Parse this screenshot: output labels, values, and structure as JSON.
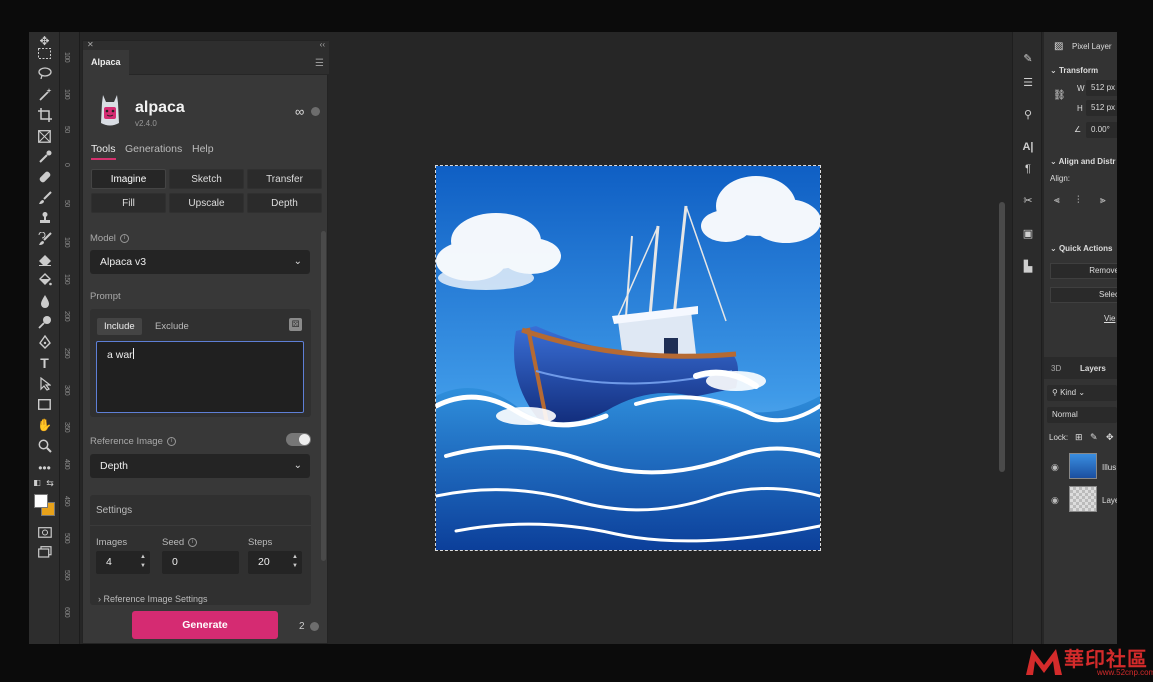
{
  "panel": {
    "tab_label": "Alpaca",
    "app_name": "alpaca",
    "version": "v2.4.0",
    "credits_symbol": "∞",
    "tabs": [
      {
        "label": "Tools",
        "active": true
      },
      {
        "label": "Generations",
        "active": false
      },
      {
        "label": "Help",
        "active": false
      }
    ],
    "modes": [
      {
        "label": "Imagine",
        "active": true
      },
      {
        "label": "Sketch",
        "active": false
      },
      {
        "label": "Transfer",
        "active": false
      },
      {
        "label": "Fill",
        "active": false
      },
      {
        "label": "Upscale",
        "active": false
      },
      {
        "label": "Depth",
        "active": false
      }
    ],
    "model_label": "Model",
    "model_value": "Alpaca v3",
    "prompt_label": "Prompt",
    "prompt_include": "Include",
    "prompt_exclude": "Exclude",
    "prompt_text": "a war",
    "reference_label": "Reference Image",
    "reference_enabled": true,
    "reference_value": "Depth",
    "settings_title": "Settings",
    "images_label": "Images",
    "images_value": "4",
    "seed_label": "Seed",
    "seed_value": "0",
    "steps_label": "Steps",
    "steps_value": "20",
    "reference_settings_label": "Reference Image Settings",
    "generate_label": "Generate",
    "generate_cost": "2"
  },
  "ruler": {
    "ticks": [
      "100",
      "100",
      "50",
      "0",
      "50",
      "100",
      "150",
      "200",
      "250",
      "300",
      "350",
      "400",
      "450",
      "500",
      "550",
      "600"
    ]
  },
  "properties": {
    "layer_type": "Pixel Layer",
    "transform_title": "Transform",
    "w_label": "W",
    "w_value": "512 px",
    "h_label": "H",
    "h_value": "512 px",
    "angle_value": "0.00°",
    "align_title": "Align and Distr",
    "align_label": "Align:",
    "quick_actions_title": "Quick Actions",
    "remove_label": "Remove",
    "select_label": "Selec",
    "view_label": "Vie"
  },
  "layers": {
    "tab_3d": "3D",
    "tab_layers": "Layers",
    "kind_filter": "Kind",
    "blend_mode": "Normal",
    "lock_label": "Lock:",
    "items": [
      {
        "name": "Illus"
      },
      {
        "name": "Laye"
      }
    ]
  },
  "watermark": {
    "text": "華印社區",
    "url": "www.52cnp.com"
  },
  "colors": {
    "accent": "#d52b72",
    "foreground": "#ffffff",
    "background_swatch": "#e8a21a",
    "focus_border": "#5e7fd6"
  },
  "icons": [
    "move-icon",
    "marquee-icon",
    "lasso-icon",
    "magic-wand-icon",
    "crop-icon",
    "frame-icon",
    "eyedropper-icon",
    "healing-brush-icon",
    "brush-icon",
    "stamp-icon",
    "history-brush-icon",
    "eraser-icon",
    "paint-bucket-icon",
    "blur-icon",
    "dodge-icon",
    "pen-icon",
    "type-icon",
    "path-select-icon",
    "rectangle-icon",
    "hand-icon",
    "zoom-icon",
    "more-icon"
  ]
}
